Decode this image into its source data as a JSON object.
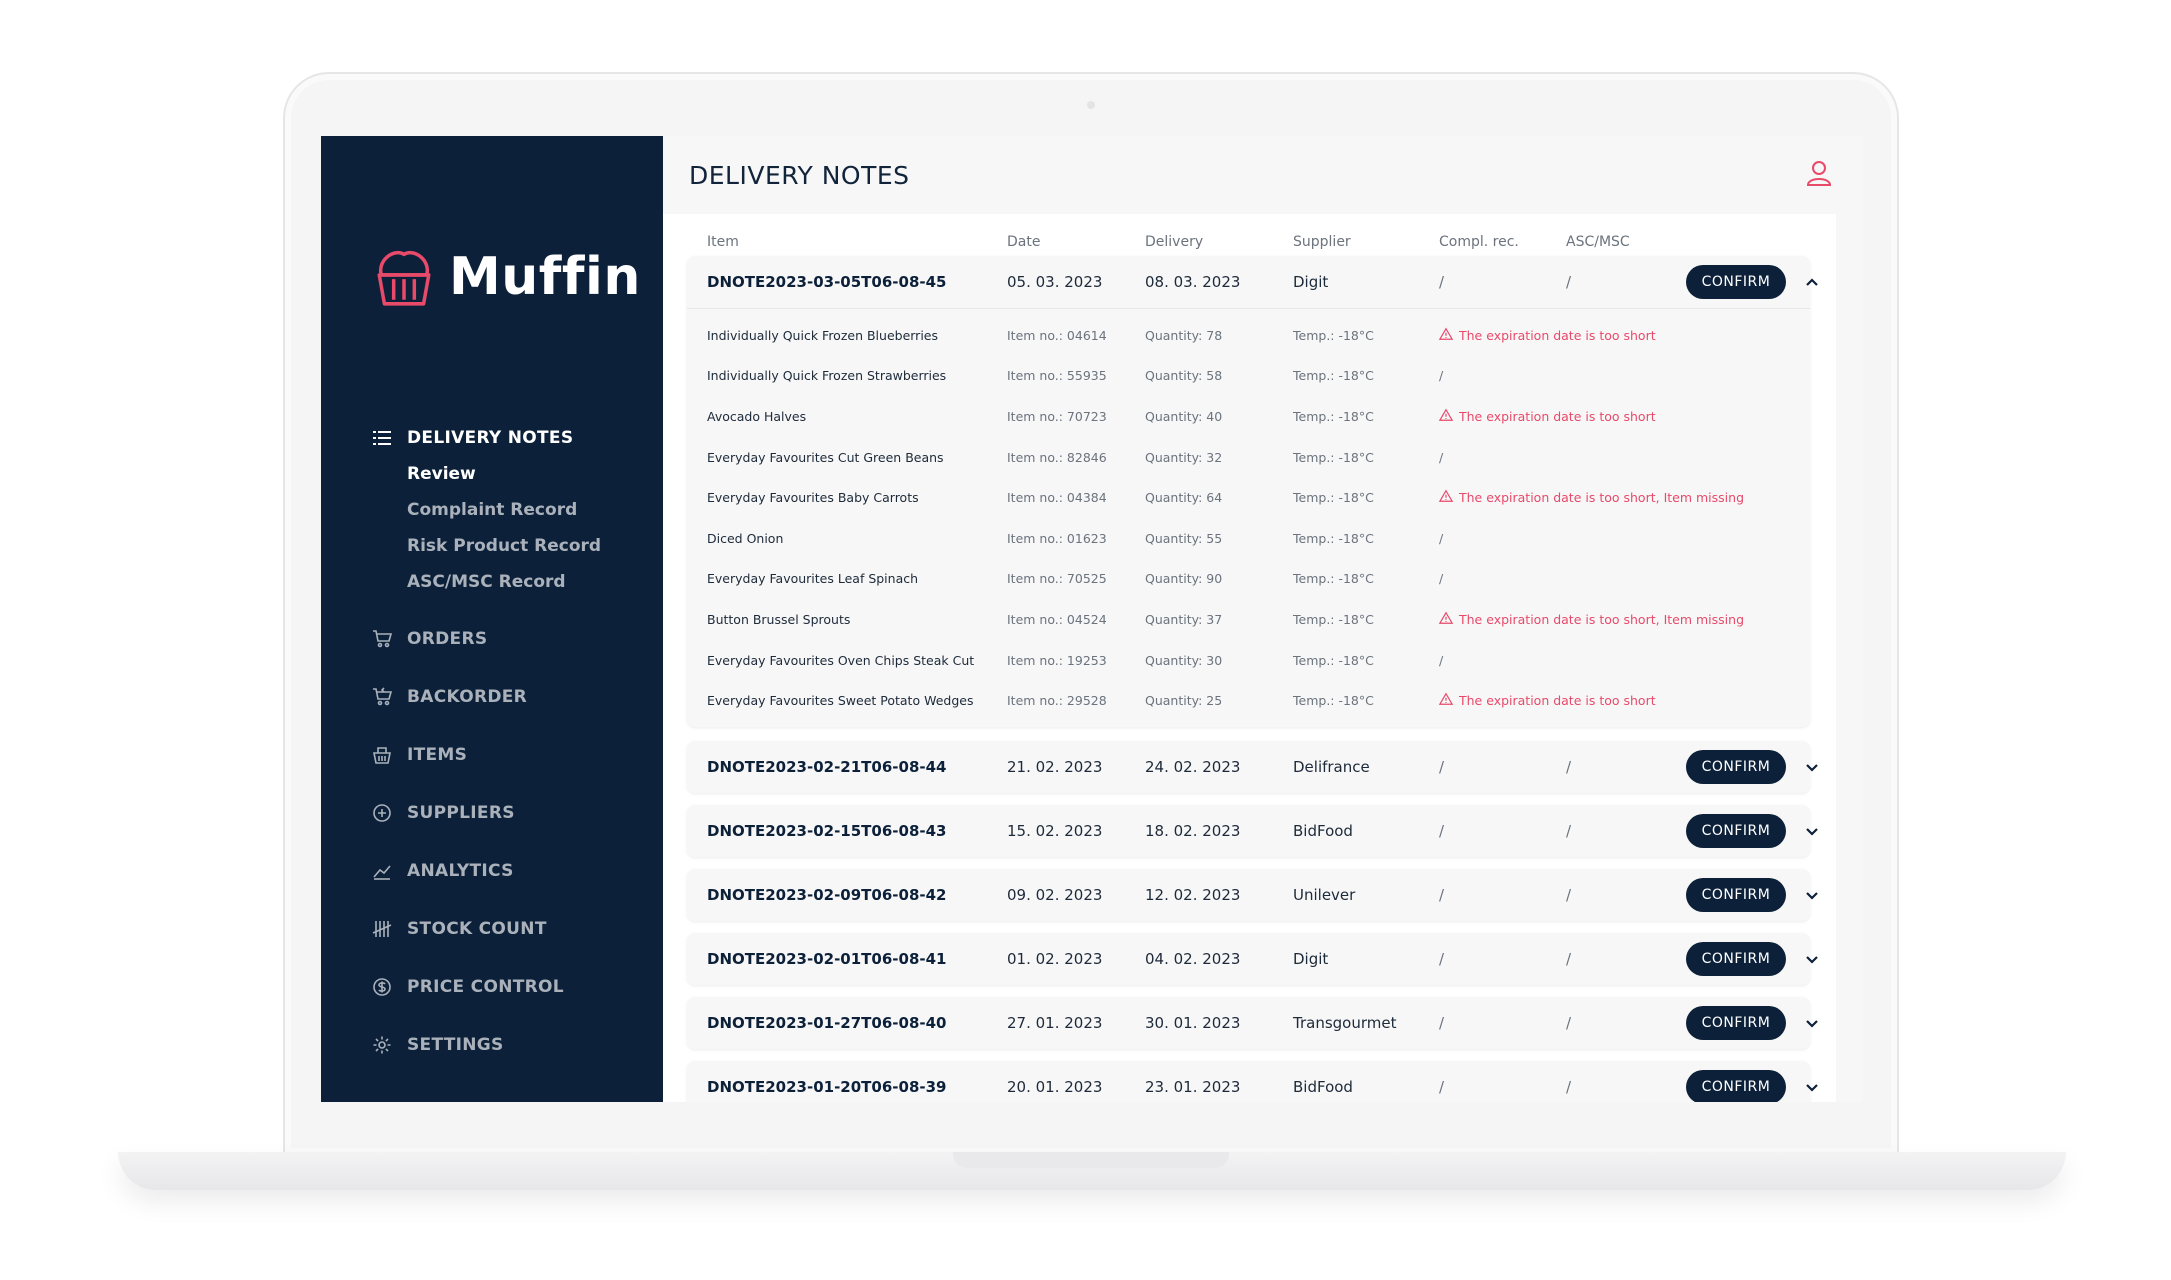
{
  "app": {
    "name": "Muffin"
  },
  "colors": {
    "navy": "#0c2139",
    "accent": "#e84a6a",
    "bg": "#f7f7f8"
  },
  "nav": {
    "delivery_notes": "DELIVERY NOTES",
    "sub": [
      "Review",
      "Complaint Record",
      "Risk Product Record",
      "ASC/MSC Record"
    ],
    "items": [
      {
        "label": "ORDERS",
        "icon": "cart-icon"
      },
      {
        "label": "BACKORDER",
        "icon": "cart-return-icon"
      },
      {
        "label": "ITEMS",
        "icon": "basket-icon"
      },
      {
        "label": "SUPPLIERS",
        "icon": "plus-circle-icon"
      },
      {
        "label": "ANALYTICS",
        "icon": "chart-line-icon"
      },
      {
        "label": "STOCK COUNT",
        "icon": "tally-icon"
      },
      {
        "label": "PRICE CONTROL",
        "icon": "dollar-circle-icon"
      },
      {
        "label": "SETTINGS",
        "icon": "gear-icon"
      }
    ]
  },
  "page": {
    "title": "DELIVERY NOTES"
  },
  "columns": {
    "item": "Item",
    "date": "Date",
    "delivery": "Delivery",
    "supplier": "Supplier",
    "compl": "Compl. rec.",
    "asc": "ASC/MSC"
  },
  "confirm_label": "CONFIRM",
  "notes": [
    {
      "id": "DNOTE2023-03-05T06-08-45",
      "date": "05. 03. 2023",
      "delivery": "08. 03. 2023",
      "supplier": "Digit",
      "compl": "/",
      "asc": "/"
    },
    {
      "id": "DNOTE2023-02-21T06-08-44",
      "date": "21. 02. 2023",
      "delivery": "24. 02. 2023",
      "supplier": "Delifrance",
      "compl": "/",
      "asc": "/"
    },
    {
      "id": "DNOTE2023-02-15T06-08-43",
      "date": "15. 02. 2023",
      "delivery": "18. 02. 2023",
      "supplier": "BidFood",
      "compl": "/",
      "asc": "/"
    },
    {
      "id": "DNOTE2023-02-09T06-08-42",
      "date": "09. 02. 2023",
      "delivery": "12. 02. 2023",
      "supplier": "Unilever",
      "compl": "/",
      "asc": "/"
    },
    {
      "id": "DNOTE2023-02-01T06-08-41",
      "date": "01. 02. 2023",
      "delivery": "04. 02. 2023",
      "supplier": "Digit",
      "compl": "/",
      "asc": "/"
    },
    {
      "id": "DNOTE2023-01-27T06-08-40",
      "date": "27. 01. 2023",
      "delivery": "30. 01. 2023",
      "supplier": "Transgourmet",
      "compl": "/",
      "asc": "/"
    },
    {
      "id": "DNOTE2023-01-20T06-08-39",
      "date": "20. 01. 2023",
      "delivery": "23. 01. 2023",
      "supplier": "BidFood",
      "compl": "/",
      "asc": "/"
    }
  ],
  "lines": [
    {
      "name": "Individually Quick Frozen Blueberries",
      "itemno": "Item no.: 04614",
      "qty": "Quantity: 78",
      "temp": "Temp.: -18°C",
      "status": "The expiration date is too short"
    },
    {
      "name": "Individually Quick Frozen Strawberries",
      "itemno": "Item no.: 55935",
      "qty": "Quantity: 58",
      "temp": "Temp.: -18°C",
      "status": "/"
    },
    {
      "name": "Avocado Halves",
      "itemno": "Item no.: 70723",
      "qty": "Quantity: 40",
      "temp": "Temp.: -18°C",
      "status": "The expiration date is too short"
    },
    {
      "name": "Everyday Favourites Cut Green Beans",
      "itemno": "Item no.: 82846",
      "qty": "Quantity: 32",
      "temp": "Temp.: -18°C",
      "status": "/"
    },
    {
      "name": "Everyday Favourites Baby Carrots",
      "itemno": "Item no.: 04384",
      "qty": "Quantity: 64",
      "temp": "Temp.: -18°C",
      "status": "The expiration date is too short, Item missing"
    },
    {
      "name": "Diced Onion",
      "itemno": "Item no.: 01623",
      "qty": "Quantity: 55",
      "temp": "Temp.: -18°C",
      "status": "/"
    },
    {
      "name": "Everyday Favourites Leaf Spinach",
      "itemno": "Item no.: 70525",
      "qty": "Quantity: 90",
      "temp": "Temp.: -18°C",
      "status": "/"
    },
    {
      "name": "Button Brussel Sprouts",
      "itemno": "Item no.: 04524",
      "qty": "Quantity: 37",
      "temp": "Temp.: -18°C",
      "status": "The expiration date is too short, Item missing"
    },
    {
      "name": "Everyday Favourites Oven Chips Steak Cut",
      "itemno": "Item no.: 19253",
      "qty": "Quantity: 30",
      "temp": "Temp.: -18°C",
      "status": "/"
    },
    {
      "name": "Everyday Favourites Sweet Potato Wedges",
      "itemno": "Item no.: 29528",
      "qty": "Quantity: 25",
      "temp": "Temp.: -18°C",
      "status": "The expiration date is too short"
    }
  ]
}
